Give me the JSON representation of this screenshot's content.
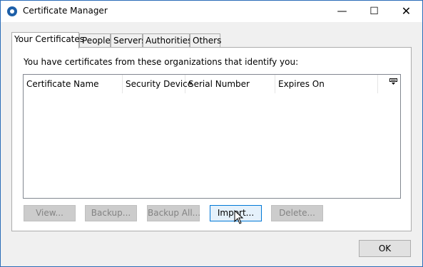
{
  "window": {
    "title": "Certificate Manager",
    "controls": {
      "minimize": "—",
      "maximize": "☐",
      "close": "✕"
    }
  },
  "tabs": [
    {
      "label": "Your Certificates",
      "active": true
    },
    {
      "label": "People",
      "active": false
    },
    {
      "label": "Servers",
      "active": false
    },
    {
      "label": "Authorities",
      "active": false
    },
    {
      "label": "Others",
      "active": false
    }
  ],
  "panel": {
    "intro": "You have certificates from these organizations that identify you:",
    "columns": [
      "Certificate Name",
      "Security Device",
      "Serial Number",
      "Expires On"
    ],
    "rows": []
  },
  "buttons": {
    "view": "View...",
    "backup": "Backup...",
    "backup_all": "Backup All...",
    "import": "Import...",
    "delete": "Delete..."
  },
  "footer": {
    "ok": "OK"
  },
  "icons": {
    "app": "thunderbird-icon",
    "column_picker": "column-picker-icon",
    "cursor": "hand-cursor-icon"
  }
}
